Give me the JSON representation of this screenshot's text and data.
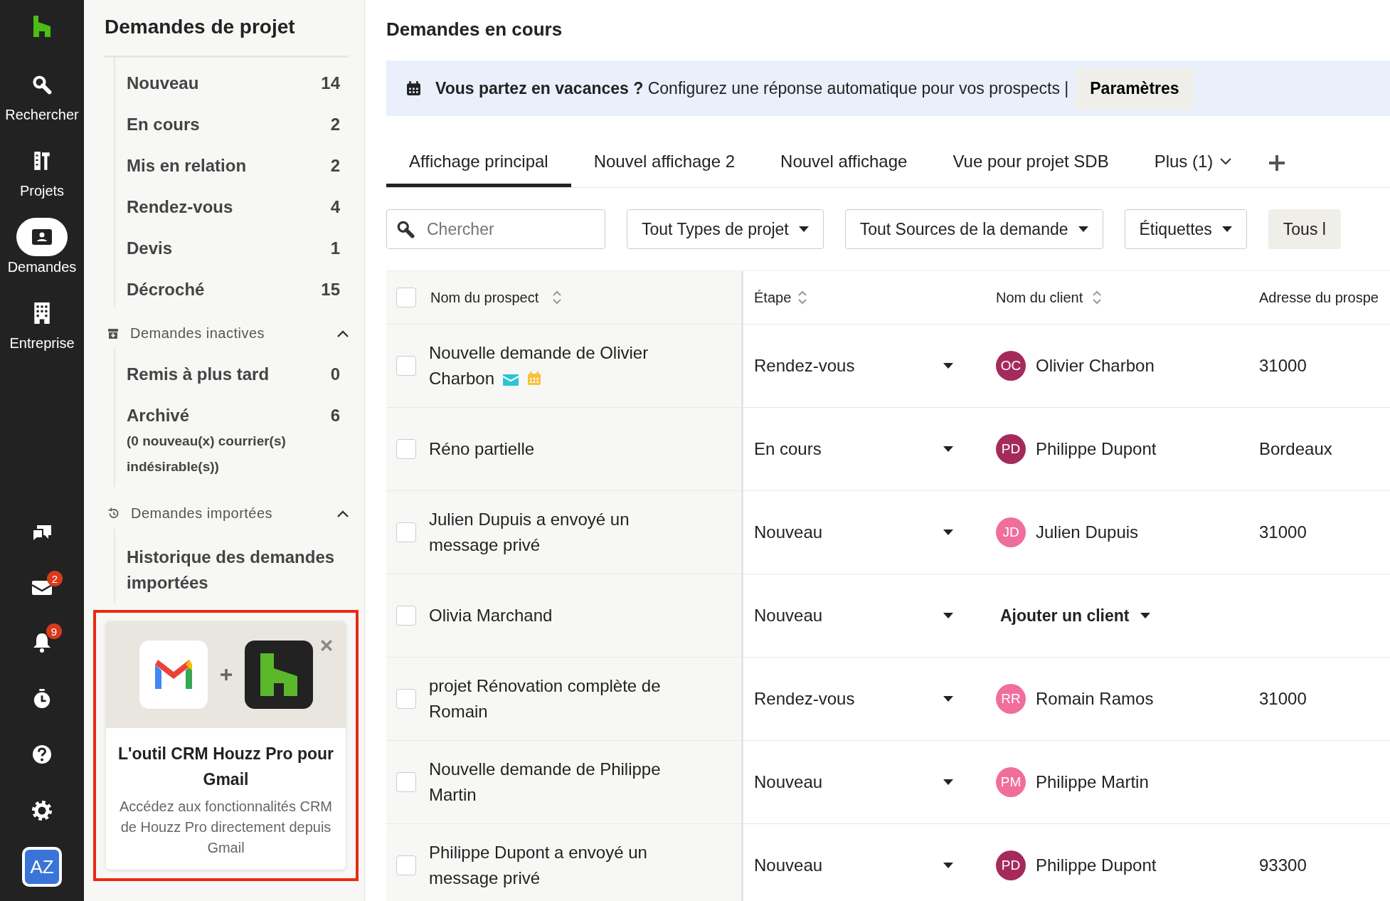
{
  "rail": {
    "items": [
      {
        "label": "Rechercher",
        "selected": false
      },
      {
        "label": "Projets",
        "selected": false
      },
      {
        "label": "Demandes",
        "selected": true
      },
      {
        "label": "Entreprise",
        "selected": false
      }
    ],
    "mail_badge": "2",
    "bell_badge": "9",
    "avatar": "AZ"
  },
  "sidebar": {
    "title": "Demandes de projet",
    "items": [
      {
        "label": "Nouveau",
        "count": "14"
      },
      {
        "label": "En cours",
        "count": "2"
      },
      {
        "label": "Mis en relation",
        "count": "2"
      },
      {
        "label": "Rendez-vous",
        "count": "4"
      },
      {
        "label": "Devis",
        "count": "1"
      },
      {
        "label": "Décroché",
        "count": "15"
      }
    ],
    "sections": [
      {
        "title": "Demandes inactives",
        "expanded": true,
        "items": [
          {
            "label": "Remis à plus tard",
            "count": "0"
          },
          {
            "label": "Archivé",
            "count": "6",
            "note": "(0 nouveau(x) courrier(s) indésirable(s))"
          }
        ]
      },
      {
        "title": "Demandes importées",
        "expanded": true,
        "items": [
          {
            "label": "Historique des demandes importées"
          }
        ]
      }
    ],
    "promo": {
      "title": "L'outil CRM Houzz Pro pour Gmail",
      "text": "Accédez aux fonctionnalités CRM de Houzz Pro directement depuis Gmail",
      "highlighted": true
    }
  },
  "main": {
    "title": "Demandes en cours",
    "banner": {
      "bold": "Vous partez en vacances ?",
      "text": "Configurez une réponse automatique pour vos prospects |",
      "button": "Paramètres"
    },
    "tabs": [
      {
        "label": "Affichage principal",
        "selected": true
      },
      {
        "label": "Nouvel affichage 2",
        "selected": false
      },
      {
        "label": "Nouvel affichage",
        "selected": false
      },
      {
        "label": "Vue pour projet SDB",
        "selected": false
      }
    ],
    "more_tab": "Plus (1)",
    "search": {
      "placeholder": "Chercher"
    },
    "filters": [
      "Tout Types de projet",
      "Tout Sources de la demande",
      "Étiquettes"
    ],
    "cut_button": "Tous l",
    "table": {
      "header_checked": false,
      "columns": [
        "Nom du prospect",
        "Étape",
        "Nom du client",
        "Adresse du prospe"
      ],
      "rows": [
        {
          "checked": false,
          "prospect": "Nouvelle demande de Olivier Charbon",
          "has_message": true,
          "has_event": true,
          "stage": "Rendez-vous",
          "client": {
            "initials": "OC",
            "name": "Olivier Charbon",
            "color": "#a52a5c"
          },
          "address": "31000"
        },
        {
          "checked": false,
          "prospect": "Réno partielle",
          "has_message": false,
          "has_event": false,
          "stage": "En cours",
          "client": {
            "initials": "PD",
            "name": "Philippe Dupont",
            "color": "#a52a5c"
          },
          "address": "Bordeaux"
        },
        {
          "checked": false,
          "prospect": "Julien Dupuis a envoyé un message privé",
          "has_message": false,
          "has_event": false,
          "stage": "Nouveau",
          "client": {
            "initials": "JD",
            "name": "Julien Dupuis",
            "color": "#f06e9c"
          },
          "address": "31000"
        },
        {
          "checked": false,
          "prospect": "Olivia Marchand",
          "has_message": false,
          "has_event": false,
          "stage": "Nouveau",
          "add_client": "Ajouter un client"
        },
        {
          "checked": false,
          "prospect": "projet Rénovation complète de Romain",
          "has_message": false,
          "has_event": false,
          "stage": "Rendez-vous",
          "client": {
            "initials": "RR",
            "name": "Romain Ramos",
            "color": "#f06e9c"
          },
          "address": "31000"
        },
        {
          "checked": false,
          "prospect": "Nouvelle demande de Philippe Martin",
          "has_message": false,
          "has_event": false,
          "stage": "Nouveau",
          "client": {
            "initials": "PM",
            "name": "Philippe Martin",
            "color": "#f06e9c"
          }
        },
        {
          "checked": false,
          "prospect": "Philippe Dupont a envoyé un message privé",
          "has_message": false,
          "has_event": false,
          "stage": "Nouveau",
          "client": {
            "initials": "PD",
            "name": "Philippe Dupont",
            "color": "#a52a5c"
          },
          "address": "93300"
        }
      ]
    }
  }
}
